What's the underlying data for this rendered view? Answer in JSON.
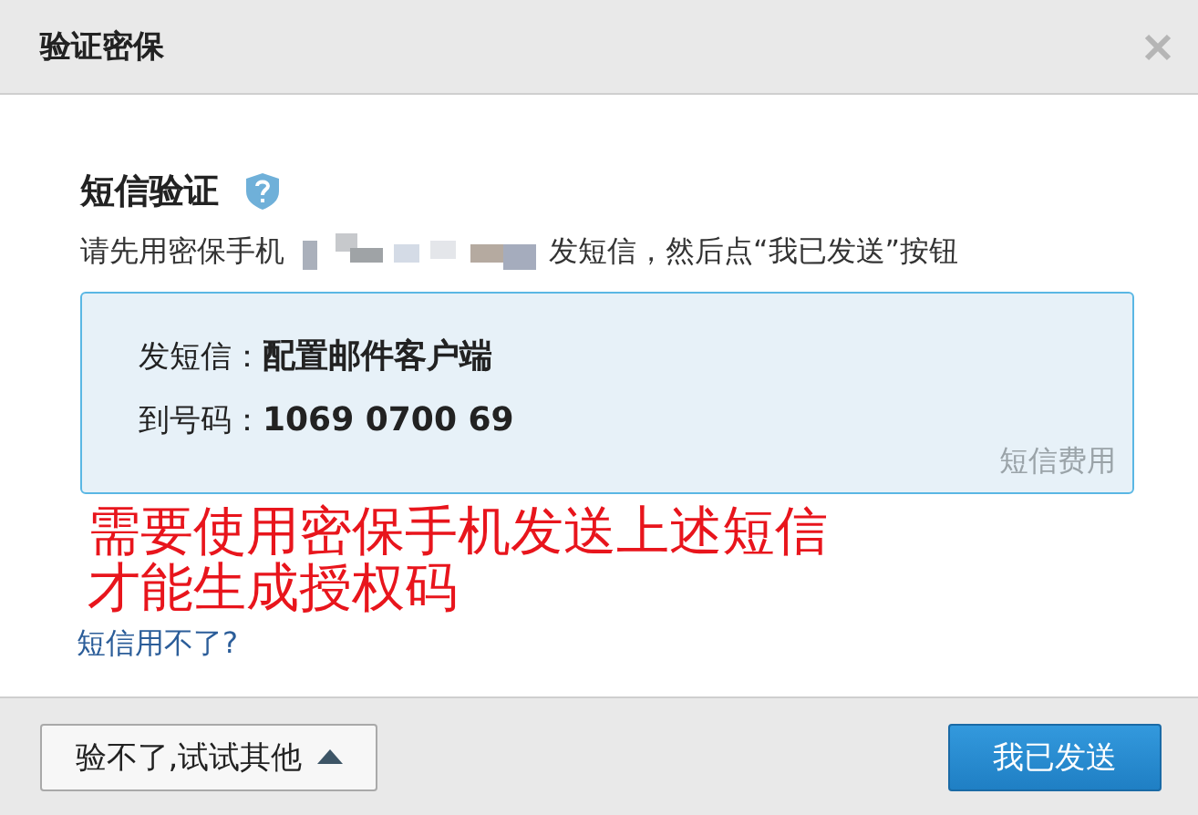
{
  "window": {
    "title": "验证密保"
  },
  "heading": "短信验证",
  "instruction": {
    "before": "请先用密保手机",
    "after": "发短信，然后点“我已发送”按钮"
  },
  "sms_box": {
    "rows": [
      {
        "label": "发短信：",
        "value": "配置邮件客户端"
      },
      {
        "label": "到号码：",
        "value": "1069 0700 69"
      }
    ],
    "fee_link": "短信费用"
  },
  "annotation": [
    "需要使用密保手机发送上述短信",
    "才能生成授权码"
  ],
  "help_link": "短信用不了?",
  "buttons": [
    {
      "label": "验不了,试试其他",
      "kind": "menu"
    },
    {
      "label": "我已发送",
      "kind": "primary"
    }
  ]
}
